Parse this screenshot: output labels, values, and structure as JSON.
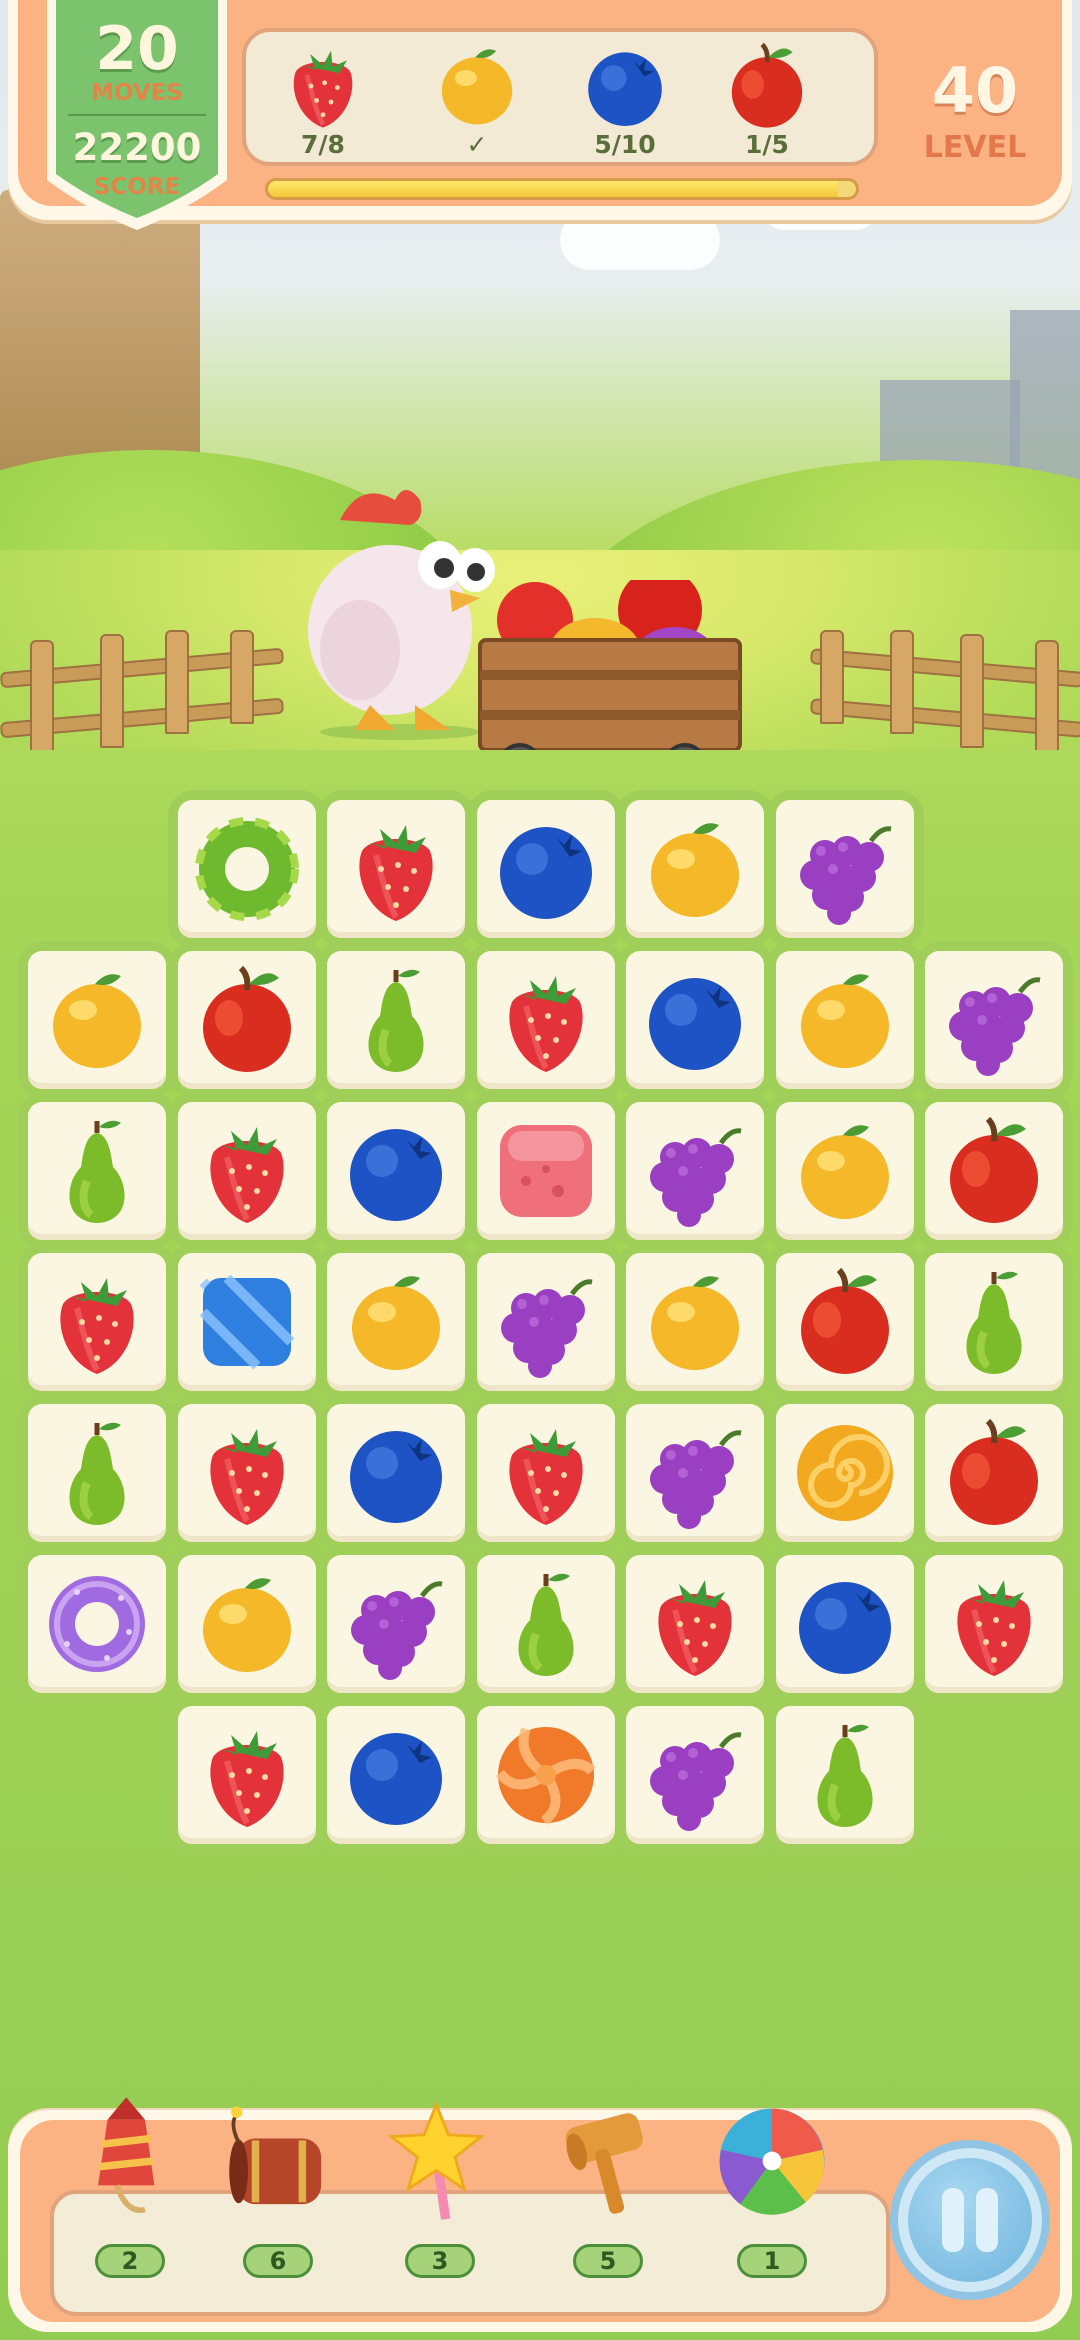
{
  "hud": {
    "moves_value": "20",
    "moves_label": "MOVES",
    "score_value": "22200",
    "score_label": "SCORE",
    "level_value": "40",
    "level_label": "LEVEL",
    "goals": [
      {
        "fruit": "strawberry",
        "progress": "7/8"
      },
      {
        "fruit": "lemon",
        "progress": "✓"
      },
      {
        "fruit": "blueberry",
        "progress": "5/10"
      },
      {
        "fruit": "apple",
        "progress": "1/5"
      }
    ],
    "progress_fraction": 0.97
  },
  "board": {
    "rows": [
      [
        "",
        "donut-green",
        "strawberry",
        "blueberry",
        "lemon",
        "grape",
        ""
      ],
      [
        "lemon",
        "apple",
        "pear",
        "strawberry",
        "blueberry",
        "lemon",
        "grape"
      ],
      [
        "pear",
        "strawberry",
        "blueberry",
        "jelly-red",
        "grape",
        "lemon",
        "apple"
      ],
      [
        "strawberry",
        "candy-blue",
        "lemon",
        "grape",
        "lemon",
        "apple",
        "pear"
      ],
      [
        "pear",
        "strawberry",
        "blueberry",
        "strawberry",
        "grape",
        "swirl-orange",
        "apple"
      ],
      [
        "donut-purple",
        "lemon",
        "grape",
        "pear",
        "strawberry",
        "blueberry",
        "strawberry"
      ],
      [
        "",
        "strawberry",
        "blueberry",
        "candy-orange",
        "grape",
        "pear",
        ""
      ]
    ]
  },
  "boosters": [
    {
      "name": "rocket-icon",
      "count": "2"
    },
    {
      "name": "barrel-bomb-icon",
      "count": "6"
    },
    {
      "name": "star-wand-icon",
      "count": "3"
    },
    {
      "name": "hammer-icon",
      "count": "5"
    },
    {
      "name": "rainbow-candy-icon",
      "count": "1"
    }
  ],
  "colors": {
    "hud_orange": "#fbb384",
    "badge_green": "#7cc36d",
    "board_tile": "#fbf6e2"
  }
}
